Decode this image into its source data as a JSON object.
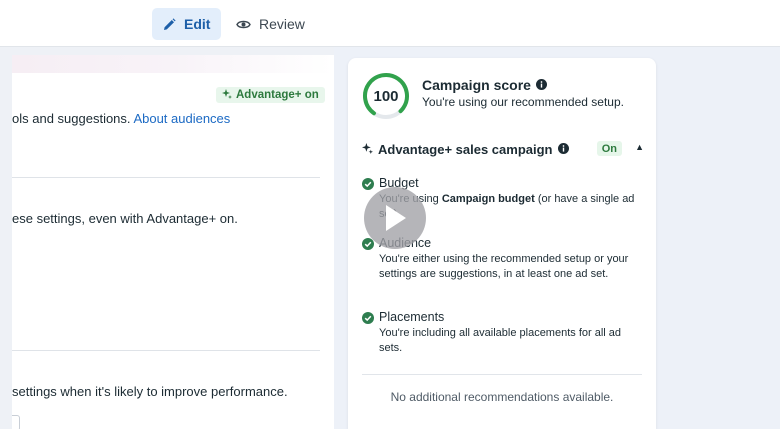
{
  "toolbar": {
    "edit_label": "Edit",
    "review_label": "Review"
  },
  "left": {
    "advantage_badge": "Advantage+ on",
    "line1_text": "ols and suggestions.",
    "line1_link": "About audiences",
    "line2_text": "ese settings, even with Advantage+ on.",
    "line3_text": "settings when it's likely to improve performance."
  },
  "score": {
    "value": "100",
    "fraction": 0.78,
    "title": "Campaign score",
    "subtitle": "You're using our recommended setup.",
    "ring_color": "#31a24c"
  },
  "sales": {
    "title": "Advantage+ sales campaign",
    "status": "On"
  },
  "items": [
    {
      "title": "Budget",
      "desc_before": "You're using",
      "desc_bold": "Campaign budget",
      "desc_after": "(or have a single ad set)."
    },
    {
      "title": "Audience",
      "desc": "You're either using the recommended setup or your settings are suggestions, in at least one ad set."
    },
    {
      "title": "Placements",
      "desc": "You're including all available placements for all ad sets."
    }
  ],
  "footer": {
    "no_recs": "No additional recommendations available."
  },
  "icons": {
    "edit": "pencil-icon",
    "review": "eye-icon",
    "info": "info-icon",
    "sparkle": "sparkle-icon",
    "check": "check-circle-icon",
    "play": "play-icon"
  }
}
